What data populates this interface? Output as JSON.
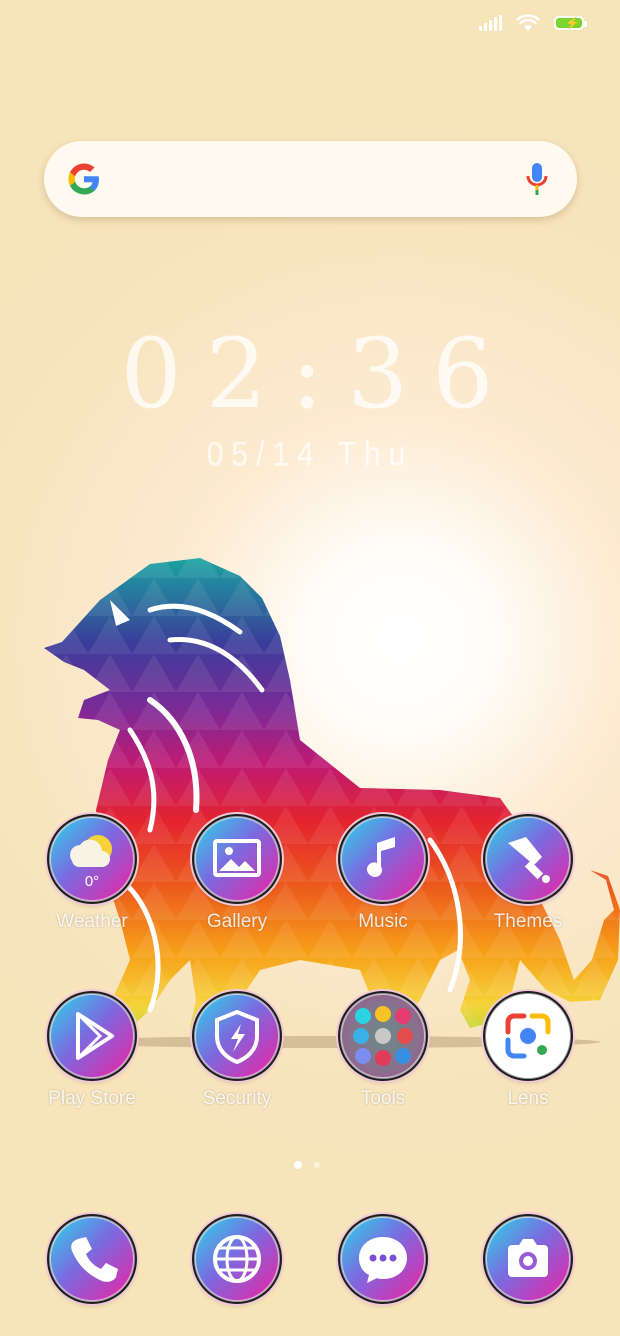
{
  "status_bar": {
    "icons": [
      "signal-icon",
      "wifi-icon",
      "battery-charging-icon"
    ]
  },
  "search": {
    "icons": [
      "google-g-icon",
      "microphone-icon"
    ]
  },
  "clock": {
    "time": "02:36",
    "date": "05/14 Thu"
  },
  "apps": [
    {
      "label": "Weather",
      "badge": "0°",
      "icon": "weather-icon"
    },
    {
      "label": "Gallery",
      "icon": "gallery-icon"
    },
    {
      "label": "Music",
      "icon": "music-icon"
    },
    {
      "label": "Themes",
      "icon": "themes-brush-icon"
    },
    {
      "label": "Play Store",
      "icon": "play-store-icon"
    },
    {
      "label": "Security",
      "icon": "security-shield-icon"
    },
    {
      "label": "Tools",
      "icon": "tools-folder-icon"
    },
    {
      "label": "Lens",
      "icon": "lens-icon"
    }
  ],
  "page_indicator": {
    "pages": 2,
    "current": 1
  },
  "dock": [
    {
      "icon": "phone-icon"
    },
    {
      "icon": "browser-globe-icon"
    },
    {
      "icon": "messages-icon"
    },
    {
      "icon": "camera-icon"
    }
  ],
  "colors": {
    "background": "#f7e4b8",
    "icon_gradient_start": "#2ad8e8",
    "icon_gradient_end": "#f01fa0",
    "battery": "#7cd42f"
  }
}
